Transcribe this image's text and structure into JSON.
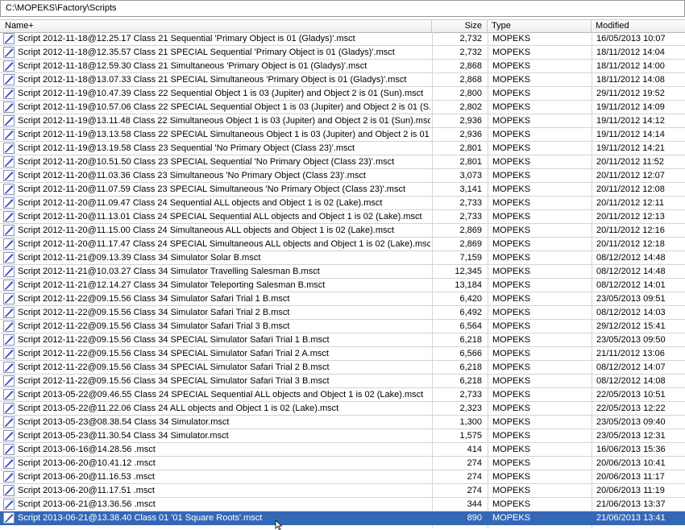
{
  "path": "C:\\MOPEKS\\Factory\\Scripts",
  "columns": {
    "name": "Name+",
    "size": "Size",
    "type": "Type",
    "modified": "Modified"
  },
  "icons": {
    "file": "script-file-icon",
    "pointer": "mouse-pointer-icon"
  },
  "colors": {
    "selected_row": "#3567b7",
    "icon_blue": "#2b49c8"
  },
  "files": [
    {
      "name": "Script 2012-11-18@12.25.17 Class 21 Sequential 'Primary Object is 01 (Gladys)'.msct",
      "size": "2,732",
      "type": "MOPEKS",
      "modified": "16/05/2013 10:07"
    },
    {
      "name": "Script 2012-11-18@12.35.57 Class 21 SPECIAL Sequential 'Primary Object is 01 (Gladys)'.msct",
      "size": "2,732",
      "type": "MOPEKS",
      "modified": "18/11/2012 14:04"
    },
    {
      "name": "Script 2012-11-18@12.59.30 Class 21 Simultaneous 'Primary Object is 01 (Gladys)'.msct",
      "size": "2,868",
      "type": "MOPEKS",
      "modified": "18/11/2012 14:00"
    },
    {
      "name": "Script 2012-11-18@13.07.33 Class 21 SPECIAL Simultaneous 'Primary Object is 01 (Gladys)'.msct",
      "size": "2,868",
      "type": "MOPEKS",
      "modified": "18/11/2012 14:08"
    },
    {
      "name": "Script 2012-11-19@10.47.39 Class 22 Sequential Object 1 is 03 (Jupiter) and Object 2 is 01 (Sun).msct",
      "size": "2,800",
      "type": "MOPEKS",
      "modified": "29/11/2012 19:52"
    },
    {
      "name": "Script 2012-11-19@10.57.06 Class 22 SPECIAL Sequential Object 1 is 03 (Jupiter) and Object 2 is 01 (S...",
      "size": "2,802",
      "type": "MOPEKS",
      "modified": "19/11/2012 14:09"
    },
    {
      "name": "Script 2012-11-19@13.11.48 Class 22 Simultaneous Object 1 is 03 (Jupiter) and Object 2 is 01 (Sun).msct",
      "size": "2,936",
      "type": "MOPEKS",
      "modified": "19/11/2012 14:12"
    },
    {
      "name": "Script 2012-11-19@13.13.58 Class 22 SPECIAL Simultaneous Object 1 is 03 (Jupiter) and Object 2 is 01 ...",
      "size": "2,936",
      "type": "MOPEKS",
      "modified": "19/11/2012 14:14"
    },
    {
      "name": "Script 2012-11-19@13.19.58 Class 23 Sequential 'No Primary Object (Class 23)'.msct",
      "size": "2,801",
      "type": "MOPEKS",
      "modified": "19/11/2012 14:21"
    },
    {
      "name": "Script 2012-11-20@10.51.50 Class 23 SPECIAL Sequential 'No Primary Object (Class 23)'.msct",
      "size": "2,801",
      "type": "MOPEKS",
      "modified": "20/11/2012 11:52"
    },
    {
      "name": "Script 2012-11-20@11.03.36 Class 23 Simultaneous 'No Primary Object (Class 23)'.msct",
      "size": "3,073",
      "type": "MOPEKS",
      "modified": "20/11/2012 12:07"
    },
    {
      "name": "Script 2012-11-20@11.07.59 Class 23 SPECIAL Simultaneous 'No Primary Object (Class 23)'.msct",
      "size": "3,141",
      "type": "MOPEKS",
      "modified": "20/11/2012 12:08"
    },
    {
      "name": "Script 2012-11-20@11.09.47 Class 24 Sequential ALL objects and Object 1 is 02 (Lake).msct",
      "size": "2,733",
      "type": "MOPEKS",
      "modified": "20/11/2012 12:11"
    },
    {
      "name": "Script 2012-11-20@11.13.01 Class 24 SPECIAL Sequential ALL objects and Object 1 is 02 (Lake).msct",
      "size": "2,733",
      "type": "MOPEKS",
      "modified": "20/11/2012 12:13"
    },
    {
      "name": "Script 2012-11-20@11.15.00 Class 24 Simultaneous ALL objects and Object 1 is 02 (Lake).msct",
      "size": "2,869",
      "type": "MOPEKS",
      "modified": "20/11/2012 12:16"
    },
    {
      "name": "Script 2012-11-20@11.17.47 Class 24 SPECIAL Simultaneous ALL objects and Object 1 is 02 (Lake).msct",
      "size": "2,869",
      "type": "MOPEKS",
      "modified": "20/11/2012 12:18"
    },
    {
      "name": "Script 2012-11-21@09.13.39 Class 34 Simulator Solar B.msct",
      "size": "7,159",
      "type": "MOPEKS",
      "modified": "08/12/2012 14:48"
    },
    {
      "name": "Script 2012-11-21@10.03.27 Class 34 Simulator Travelling Salesman B.msct",
      "size": "12,345",
      "type": "MOPEKS",
      "modified": "08/12/2012 14:48"
    },
    {
      "name": "Script 2012-11-21@12.14.27 Class 34 Simulator Teleporting Salesman B.msct",
      "size": "13,184",
      "type": "MOPEKS",
      "modified": "08/12/2012 14:01"
    },
    {
      "name": "Script 2012-11-22@09.15.56 Class 34 Simulator Safari Trial 1 B.msct",
      "size": "6,420",
      "type": "MOPEKS",
      "modified": "23/05/2013 09:51"
    },
    {
      "name": "Script 2012-11-22@09.15.56 Class 34 Simulator Safari Trial 2 B.msct",
      "size": "6,492",
      "type": "MOPEKS",
      "modified": "08/12/2012 14:03"
    },
    {
      "name": "Script 2012-11-22@09.15.56 Class 34 Simulator Safari Trial 3 B.msct",
      "size": "6,564",
      "type": "MOPEKS",
      "modified": "29/12/2012 15:41"
    },
    {
      "name": "Script 2012-11-22@09.15.56 Class 34 SPECIAL Simulator Safari Trial 1 B.msct",
      "size": "6,218",
      "type": "MOPEKS",
      "modified": "23/05/2013 09:50"
    },
    {
      "name": "Script 2012-11-22@09.15.56 Class 34 SPECIAL Simulator Safari Trial 2 A.msct",
      "size": "6,566",
      "type": "MOPEKS",
      "modified": "21/11/2012 13:06"
    },
    {
      "name": "Script 2012-11-22@09.15.56 Class 34 SPECIAL Simulator Safari Trial 2 B.msct",
      "size": "6,218",
      "type": "MOPEKS",
      "modified": "08/12/2012 14:07"
    },
    {
      "name": "Script 2012-11-22@09.15.56 Class 34 SPECIAL Simulator Safari Trial 3 B.msct",
      "size": "6,218",
      "type": "MOPEKS",
      "modified": "08/12/2012 14:08"
    },
    {
      "name": "Script 2013-05-22@09.46.55 Class 24 SPECIAL Sequential ALL objects and Object 1 is 02 (Lake).msct",
      "size": "2,733",
      "type": "MOPEKS",
      "modified": "22/05/2013 10:51"
    },
    {
      "name": "Script 2013-05-22@11.22.06 Class 24 ALL objects and Object 1 is 02 (Lake).msct",
      "size": "2,323",
      "type": "MOPEKS",
      "modified": "22/05/2013 12:22"
    },
    {
      "name": "Script 2013-05-23@08.38.54 Class 34 Simulator.msct",
      "size": "1,300",
      "type": "MOPEKS",
      "modified": "23/05/2013 09:40"
    },
    {
      "name": "Script 2013-05-23@11.30.54 Class 34 Simulator.msct",
      "size": "1,575",
      "type": "MOPEKS",
      "modified": "23/05/2013 12:31"
    },
    {
      "name": "Script 2013-06-16@14.28.56 .msct",
      "size": "414",
      "type": "MOPEKS",
      "modified": "16/06/2013 15:36"
    },
    {
      "name": "Script 2013-06-20@10.41.12 .msct",
      "size": "274",
      "type": "MOPEKS",
      "modified": "20/06/2013 10:41"
    },
    {
      "name": "Script 2013-06-20@11.16.53 .msct",
      "size": "274",
      "type": "MOPEKS",
      "modified": "20/06/2013 11:17"
    },
    {
      "name": "Script 2013-06-20@11.17.51 .msct",
      "size": "274",
      "type": "MOPEKS",
      "modified": "20/06/2013 11:19"
    },
    {
      "name": "Script 2013-06-21@13.36.56 .msct",
      "size": "344",
      "type": "MOPEKS",
      "modified": "21/06/2013 13:37"
    },
    {
      "name": "Script 2013-06-21@13.38.40 Class 01 '01 Square Roots'.msct",
      "size": "890",
      "type": "MOPEKS",
      "modified": "21/06/2013 13:41",
      "selected": true
    }
  ]
}
